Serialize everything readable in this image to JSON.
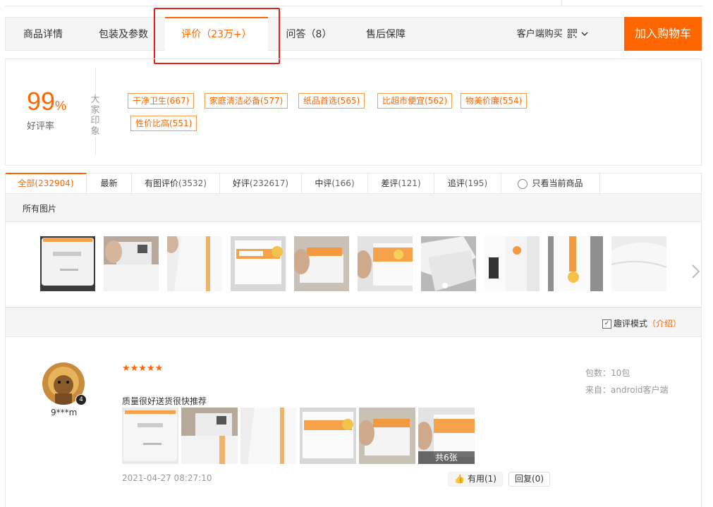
{
  "tabs": [
    {
      "label": "商品详情"
    },
    {
      "label": "包装及参数"
    },
    {
      "label": "评价（23万+）"
    },
    {
      "label": "问答（8）"
    },
    {
      "label": "售后保障"
    }
  ],
  "buy_mode_label": "客户端购买",
  "add_cart_label": "加入购物车",
  "rating": {
    "value": "99",
    "unit": "%",
    "label": "好评率"
  },
  "impression_title": "大家印象",
  "impression_tags": [
    "干净卫生(667)",
    "家庭清洁必备(577)",
    "纸品首选(565)",
    "比超市便宜(562)",
    "物美价廉(554)",
    "性价比高(551)"
  ],
  "filters": [
    {
      "label": "全部",
      "count": "(232904)"
    },
    {
      "label": "最新",
      "count": ""
    },
    {
      "label": "有图评价",
      "count": "(3532)"
    },
    {
      "label": "好评",
      "count": "(232617)"
    },
    {
      "label": "中评",
      "count": "(166)"
    },
    {
      "label": "差评",
      "count": "(121)"
    },
    {
      "label": "追评",
      "count": "(195)"
    },
    {
      "label": "只看当前商品",
      "count": ""
    }
  ],
  "all_pics_label": "所有图片",
  "fun_mode": {
    "label": "趣评模式",
    "intro": "（介绍）"
  },
  "review": {
    "username": "9***m",
    "level_badge": "4",
    "stars": "★★★★★",
    "spec": "包数：10包",
    "source": "来自：android客户端",
    "text": "质量很好送货很快推荐",
    "more_photos": "共6张",
    "date": "2021-04-27 08:27:10",
    "useful": "有用(1)",
    "reply": "回复(0)"
  },
  "colors": {
    "accent": "#ff6600",
    "highlight_border": "#e5211b"
  },
  "icons": {
    "qr": "qr-code-icon",
    "dropdown": "chevron-down-icon",
    "next": "chevron-right-icon",
    "thumb": "thumb-up-icon"
  }
}
